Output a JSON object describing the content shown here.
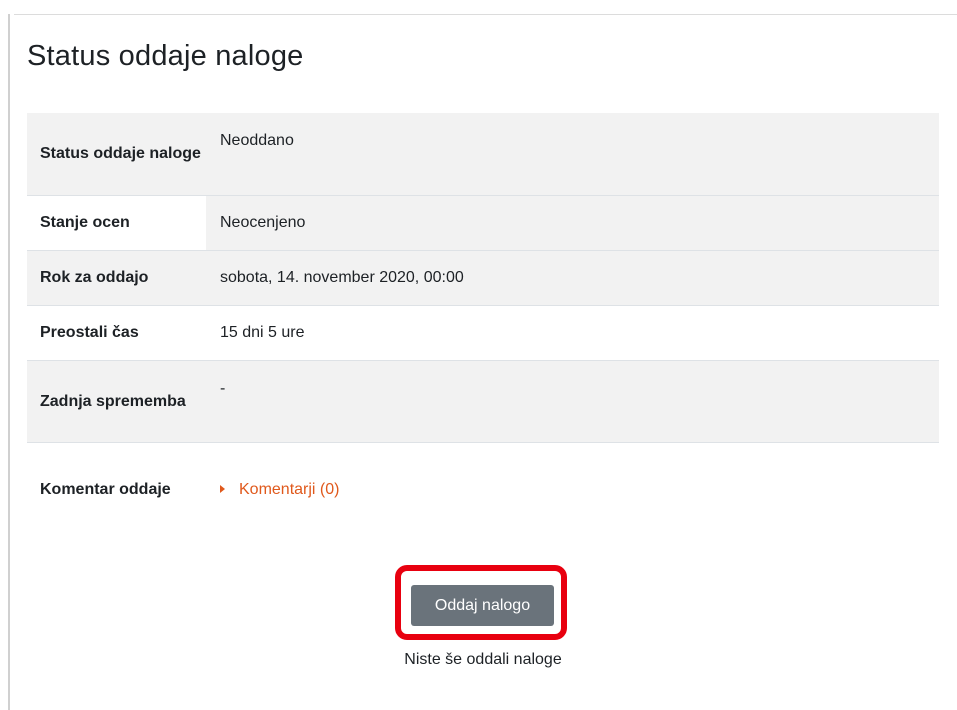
{
  "heading": "Status oddaje naloge",
  "rows": [
    {
      "label": "Status oddaje naloge",
      "value": "Neoddano"
    },
    {
      "label": "Stanje ocen",
      "value": "Neocenjeno"
    },
    {
      "label": "Rok za oddajo",
      "value": "sobota, 14. november 2020, 00:00"
    },
    {
      "label": "Preostali čas",
      "value": "15 dni 5 ure"
    },
    {
      "label": "Zadnja sprememba",
      "value": "-"
    },
    {
      "label": "Komentar oddaje",
      "value": "Komentarji (0)"
    }
  ],
  "submit": {
    "button_label": "Oddaj nalogo",
    "note": "Niste še oddali naloge"
  },
  "colors": {
    "link": "#e0591c",
    "button": "#6a737b",
    "highlight": "#e8000f",
    "row_shade": "#f2f2f2"
  },
  "icons": {
    "comments_toggle": "caret-right-icon"
  }
}
